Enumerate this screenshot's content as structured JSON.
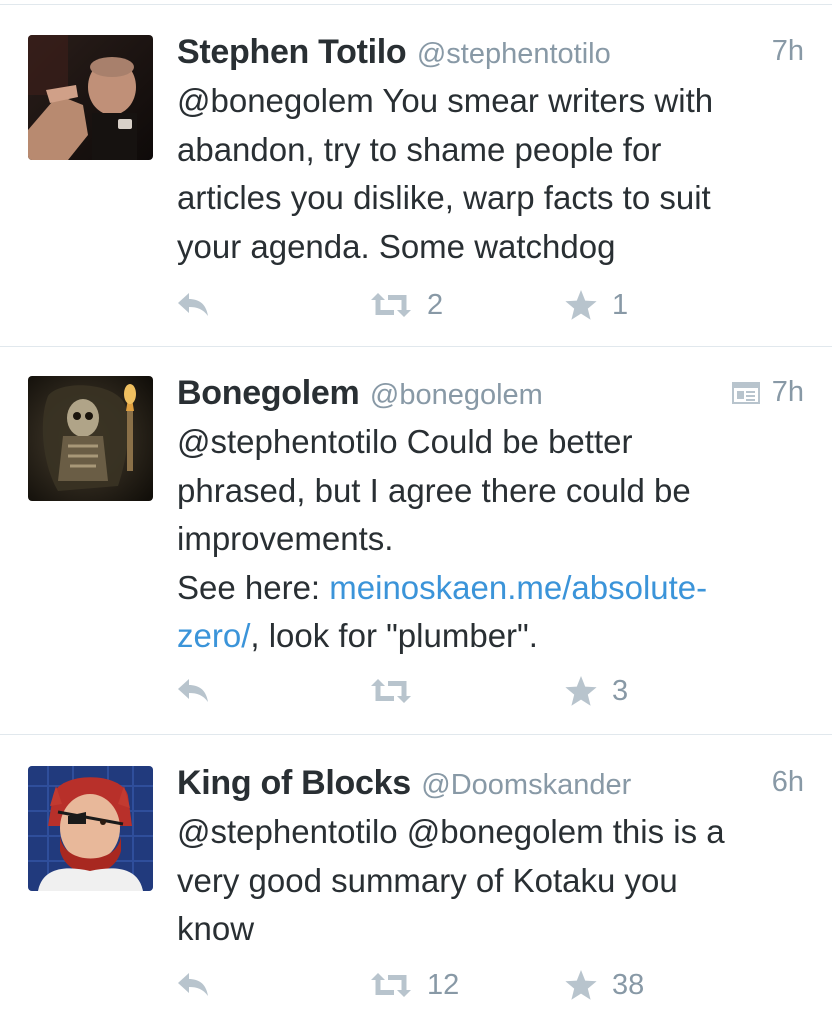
{
  "tweets": [
    {
      "name": "Stephen Totilo",
      "handle": "@stephentotilo",
      "time": "7h",
      "lines": [
        "@bonegolem You smear writers with",
        "abandon, try to shame people for",
        "articles you dislike, warp facts to suit",
        "your agenda. Some watchdog"
      ],
      "retweets": "2",
      "favorites": "1"
    },
    {
      "name": "Bonegolem",
      "handle": "@bonegolem",
      "time": "7h",
      "lines": [
        "@stephentotilo Could be better",
        "phrased, but I agree there could be",
        "improvements."
      ],
      "link_prefix": "See here: ",
      "link_part1": "meinoskaen.me/absolute-",
      "link_part2": "zero/",
      "link_suffix": ", look for \"plumber\".",
      "retweets": "",
      "favorites": "3"
    },
    {
      "name": "King of Blocks",
      "handle": "@Doomskander",
      "time": "6h",
      "lines": [
        "@stephentotilo @bonegolem this is a",
        "very good summary of Kotaku you",
        "know"
      ],
      "retweets": "12",
      "favorites": "38"
    }
  ],
  "icons": {
    "reply": "reply-icon",
    "retweet": "retweet-icon",
    "favorite": "star-icon",
    "media": "media-summary-icon"
  },
  "colors": {
    "text": "#292f33",
    "secondary": "#8899a6",
    "link": "#3b94d9",
    "icon": "#b8c4cd",
    "divider": "#e1e8ed"
  }
}
